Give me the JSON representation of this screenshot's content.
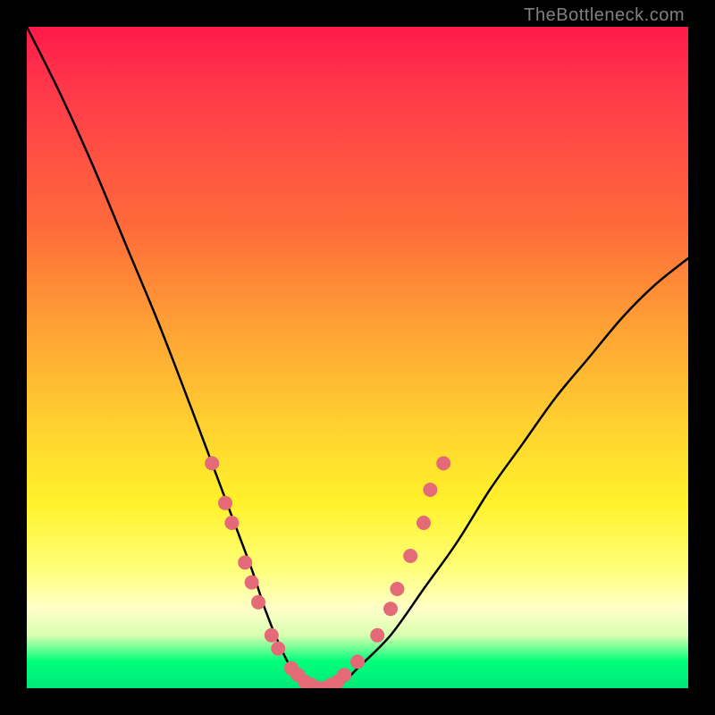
{
  "watermark": "TheBottleneck.com",
  "chart_data": {
    "type": "line",
    "title": "",
    "xlabel": "",
    "ylabel": "",
    "xlim": [
      0,
      100
    ],
    "ylim": [
      0,
      100
    ],
    "grid": false,
    "legend": false,
    "background_gradient": {
      "direction": "top-to-bottom",
      "stops": [
        {
          "pos": 0,
          "color": "#ff1a4a"
        },
        {
          "pos": 30,
          "color": "#ff6a3a"
        },
        {
          "pos": 60,
          "color": "#ffd030"
        },
        {
          "pos": 82,
          "color": "#ffffc8"
        },
        {
          "pos": 100,
          "color": "#00e878"
        }
      ]
    },
    "series": [
      {
        "name": "bottleneck-curve",
        "x": [
          0,
          5,
          10,
          15,
          20,
          25,
          28,
          31,
          34,
          36,
          38,
          40,
          42,
          44,
          46,
          48,
          50,
          55,
          60,
          65,
          70,
          75,
          80,
          85,
          90,
          95,
          100
        ],
        "y": [
          100,
          90,
          79,
          67,
          55,
          42,
          34,
          26,
          18,
          12,
          7,
          3,
          1,
          0,
          0,
          1,
          3,
          8,
          15,
          22,
          30,
          37,
          44,
          50,
          56,
          61,
          65
        ]
      }
    ],
    "markers": {
      "name": "highlighted-points",
      "color": "#e56a78",
      "points": [
        {
          "x": 28,
          "y": 34
        },
        {
          "x": 30,
          "y": 28
        },
        {
          "x": 31,
          "y": 25
        },
        {
          "x": 33,
          "y": 19
        },
        {
          "x": 34,
          "y": 16
        },
        {
          "x": 35,
          "y": 13
        },
        {
          "x": 37,
          "y": 8
        },
        {
          "x": 38,
          "y": 6
        },
        {
          "x": 40,
          "y": 3
        },
        {
          "x": 41,
          "y": 2
        },
        {
          "x": 42,
          "y": 1
        },
        {
          "x": 43,
          "y": 0.5
        },
        {
          "x": 44,
          "y": 0
        },
        {
          "x": 45,
          "y": 0
        },
        {
          "x": 46,
          "y": 0.5
        },
        {
          "x": 47,
          "y": 1
        },
        {
          "x": 48,
          "y": 2
        },
        {
          "x": 50,
          "y": 4
        },
        {
          "x": 53,
          "y": 8
        },
        {
          "x": 55,
          "y": 12
        },
        {
          "x": 56,
          "y": 15
        },
        {
          "x": 58,
          "y": 20
        },
        {
          "x": 60,
          "y": 25
        },
        {
          "x": 61,
          "y": 30
        },
        {
          "x": 63,
          "y": 34
        }
      ]
    }
  }
}
